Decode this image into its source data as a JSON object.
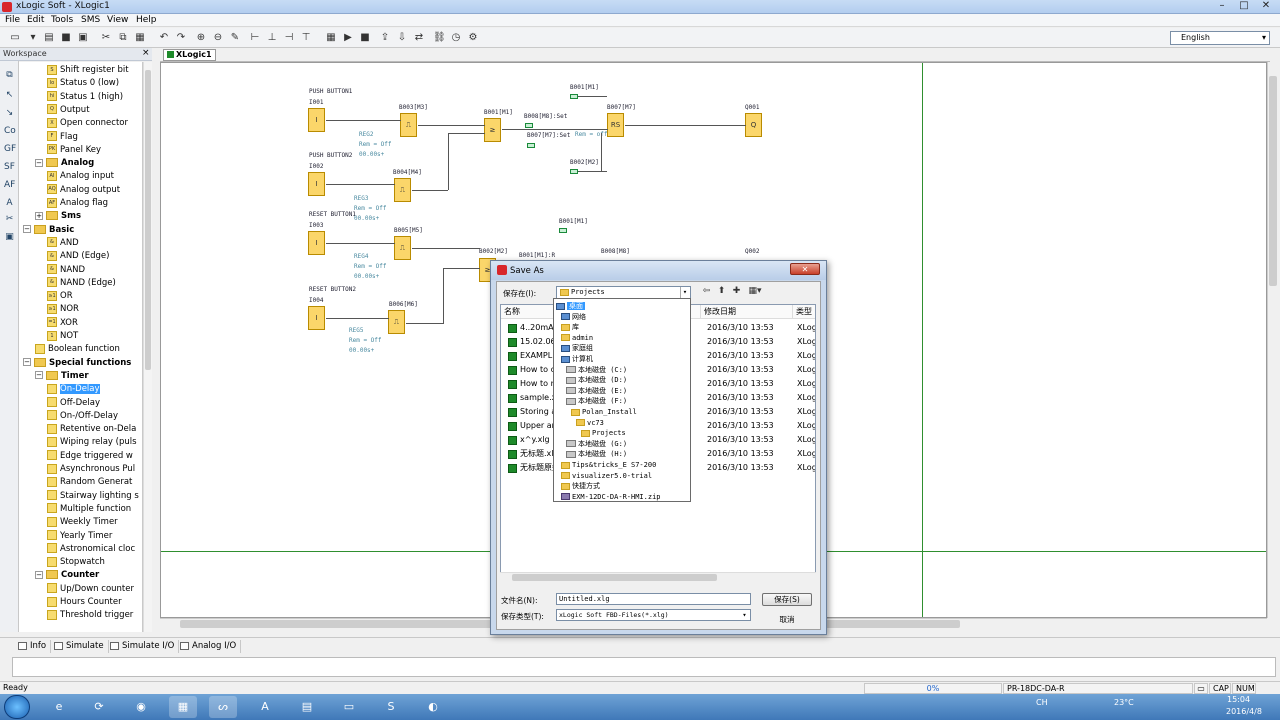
{
  "window": {
    "title": "xLogic Soft - XLogic1"
  },
  "menu": [
    "File",
    "Edit",
    "Tools",
    "SMS",
    "View",
    "Help"
  ],
  "toolbar": {
    "language": "English"
  },
  "workspace": {
    "title": "Workspace",
    "close": "×",
    "tree": [
      {
        "label": "Shift register bit",
        "type": "item",
        "icon": "S",
        "level": 2
      },
      {
        "label": "Status 0 (low)",
        "type": "item",
        "icon": "lo",
        "level": 2
      },
      {
        "label": "Status 1 (high)",
        "type": "item",
        "icon": "hi",
        "level": 2
      },
      {
        "label": "Output",
        "type": "item",
        "icon": "Q",
        "level": 2
      },
      {
        "label": "Open connector",
        "type": "item",
        "icon": "X",
        "level": 2
      },
      {
        "label": "Flag",
        "type": "item",
        "icon": "F",
        "level": 2
      },
      {
        "label": "Panel Key",
        "type": "item",
        "icon": "PK",
        "level": 2
      },
      {
        "label": "Analog",
        "type": "folder",
        "level": 1
      },
      {
        "label": "Analog input",
        "type": "item",
        "icon": "AI",
        "level": 2
      },
      {
        "label": "Analog output",
        "type": "item",
        "icon": "AQ",
        "level": 2
      },
      {
        "label": "Analog flag",
        "type": "item",
        "icon": "AF",
        "level": 2
      },
      {
        "label": "Sms",
        "type": "folder",
        "level": 1,
        "collapsed": true
      },
      {
        "label": "Basic",
        "type": "folder",
        "level": 0
      },
      {
        "label": "AND",
        "type": "item",
        "icon": "&",
        "level": 2
      },
      {
        "label": "AND (Edge)",
        "type": "item",
        "icon": "&",
        "level": 2
      },
      {
        "label": "NAND",
        "type": "item",
        "icon": "&",
        "level": 2
      },
      {
        "label": "NAND (Edge)",
        "type": "item",
        "icon": "&",
        "level": 2
      },
      {
        "label": "OR",
        "type": "item",
        "icon": "≥1",
        "level": 2
      },
      {
        "label": "NOR",
        "type": "item",
        "icon": "≥1",
        "level": 2
      },
      {
        "label": "XOR",
        "type": "item",
        "icon": "=1",
        "level": 2
      },
      {
        "label": "NOT",
        "type": "item",
        "icon": "1",
        "level": 2
      },
      {
        "label": "Boolean function",
        "type": "item",
        "icon": "",
        "level": 1
      },
      {
        "label": "Special functions",
        "type": "folder",
        "level": 0
      },
      {
        "label": "Timer",
        "type": "folder",
        "level": 1
      },
      {
        "label": "On-Delay",
        "type": "item",
        "icon": "",
        "level": 2,
        "selected": true
      },
      {
        "label": "Off-Delay",
        "type": "item",
        "icon": "",
        "level": 2
      },
      {
        "label": "On-/Off-Delay",
        "type": "item",
        "icon": "",
        "level": 2
      },
      {
        "label": "Retentive on-Dela",
        "type": "item",
        "icon": "",
        "level": 2
      },
      {
        "label": "Wiping relay (puls",
        "type": "item",
        "icon": "",
        "level": 2
      },
      {
        "label": "Edge triggered w",
        "type": "item",
        "icon": "",
        "level": 2
      },
      {
        "label": "Asynchronous Pul",
        "type": "item",
        "icon": "",
        "level": 2
      },
      {
        "label": "Random Generat",
        "type": "item",
        "icon": "",
        "level": 2
      },
      {
        "label": "Stairway lighting s",
        "type": "item",
        "icon": "",
        "level": 2
      },
      {
        "label": "Multiple function",
        "type": "item",
        "icon": "",
        "level": 2
      },
      {
        "label": "Weekly Timer",
        "type": "item",
        "icon": "",
        "level": 2
      },
      {
        "label": "Yearly Timer",
        "type": "item",
        "icon": "",
        "level": 2
      },
      {
        "label": "Astronomical cloc",
        "type": "item",
        "icon": "",
        "level": 2
      },
      {
        "label": "Stopwatch",
        "type": "item",
        "icon": "",
        "level": 2
      },
      {
        "label": "Counter",
        "type": "folder",
        "level": 1
      },
      {
        "label": "Up/Down counter",
        "type": "item",
        "icon": "",
        "level": 2
      },
      {
        "label": "Hours Counter",
        "type": "item",
        "icon": "",
        "level": 2
      },
      {
        "label": "Threshold trigger",
        "type": "item",
        "icon": "",
        "level": 2
      }
    ]
  },
  "document_tab": "XLogic1",
  "diagram": {
    "labels": [
      "PUSH BUTTON1",
      "I001",
      "PUSH BUTTON2",
      "I002",
      "RESET BUTTON1",
      "I003",
      "RESET BUTTON2",
      "I004",
      "B003[M3]",
      "B004[M4]",
      "B005[M5]",
      "B006[M6]",
      "B001[M1]",
      "B008[M8]:Set",
      "B007[M7]:Set",
      "B001[M1]",
      "B007[M7]",
      "B002[M2]",
      "Q001",
      "B001[M1]",
      "B002[M2]",
      "B001[M1]:R",
      "B008[M8]",
      "Q002"
    ],
    "params": [
      "REG2",
      "Rem = Off",
      "00.00s+",
      "REG3",
      "Rem = Off",
      "00.00s+",
      "REG4",
      "Rem = Off",
      "00.00s+",
      "REG5",
      "Rem = Off",
      "00.00s+",
      "Rem = off"
    ]
  },
  "bottom_tabs": [
    "Info",
    "Simulate",
    "Simulate I/O",
    "Analog I/O"
  ],
  "status": {
    "left": "Ready",
    "progress": "0%",
    "device": "PR-18DC-DA-R",
    "cap": "CAP",
    "num": "NUM"
  },
  "taskbar": {
    "time": "15:04",
    "date": "2016/4/8",
    "temp": "23°C",
    "lang": "CH"
  },
  "dialog": {
    "title": "Save As",
    "look_in_label": "保存在(I):",
    "look_in_value": "Projects",
    "columns": [
      "名称",
      "修改日期",
      "类型"
    ],
    "files": [
      {
        "name": "4..20mA.x",
        "date": "2016/3/10 13:53",
        "type": "XLog"
      },
      {
        "name": "15.02.06.x",
        "date": "2016/3/10 13:53",
        "type": "XLog"
      },
      {
        "name": "EXAMPLE",
        "date": "2016/3/10 13:53",
        "type": "XLog"
      },
      {
        "name": "How to cl",
        "date": "2016/3/10 13:53",
        "type": "XLog"
      },
      {
        "name": "How to m",
        "date": "2016/3/10 13:53",
        "type": "XLog"
      },
      {
        "name": "sample.xl",
        "date": "2016/3/10 13:53",
        "type": "XLog"
      },
      {
        "name": "Storing a",
        "date": "2016/3/10 13:53",
        "type": "XLog"
      },
      {
        "name": "Upper an",
        "date": "2016/3/10 13:53",
        "type": "XLog"
      },
      {
        "name": "x^y.xlg",
        "date": "2016/3/10 13:53",
        "type": "XLog"
      },
      {
        "name": "无标题.xlg",
        "date": "2016/3/10 13:53",
        "type": "XLog"
      },
      {
        "name": "无标题原始",
        "date": "2016/3/10 13:53",
        "type": "XLog"
      }
    ],
    "dropdown": [
      {
        "label": "桌面",
        "icon": "pc",
        "indent": 0,
        "selected": true
      },
      {
        "label": "网络",
        "icon": "pc",
        "indent": 1
      },
      {
        "label": "库",
        "icon": "fo",
        "indent": 1
      },
      {
        "label": "admin",
        "icon": "fo",
        "indent": 1
      },
      {
        "label": "家庭组",
        "icon": "pc",
        "indent": 1
      },
      {
        "label": "计算机",
        "icon": "pc",
        "indent": 1
      },
      {
        "label": "本地磁盘 (C:)",
        "icon": "dk",
        "indent": 2
      },
      {
        "label": "本地磁盘 (D:)",
        "icon": "dk",
        "indent": 2
      },
      {
        "label": "本地磁盘 (E:)",
        "icon": "dk",
        "indent": 2
      },
      {
        "label": "本地磁盘 (F:)",
        "icon": "dk",
        "indent": 2
      },
      {
        "label": "Polan_Install",
        "icon": "fo",
        "indent": 3
      },
      {
        "label": "vc73",
        "icon": "fo",
        "indent": 4
      },
      {
        "label": "Projects",
        "icon": "fo",
        "indent": 5
      },
      {
        "label": "本地磁盘 (G:)",
        "icon": "dk",
        "indent": 2
      },
      {
        "label": "本地磁盘 (H:)",
        "icon": "dk",
        "indent": 2
      },
      {
        "label": "Tips&tricks_E S7-200",
        "icon": "fo",
        "indent": 1
      },
      {
        "label": "visualizer5.0-trial",
        "icon": "fo",
        "indent": 1
      },
      {
        "label": "快捷方式",
        "icon": "fo",
        "indent": 1
      },
      {
        "label": "EXM-12DC-DA-R-HMI.zip",
        "icon": "zp",
        "indent": 1
      }
    ],
    "filename_label": "文件名(N):",
    "filename_value": "Untitled.xlg",
    "filetype_label": "保存类型(T):",
    "filetype_value": "xLogic Soft FBD-Files(*.xlg)",
    "save_button": "保存(S)",
    "cancel_button": "取消"
  }
}
